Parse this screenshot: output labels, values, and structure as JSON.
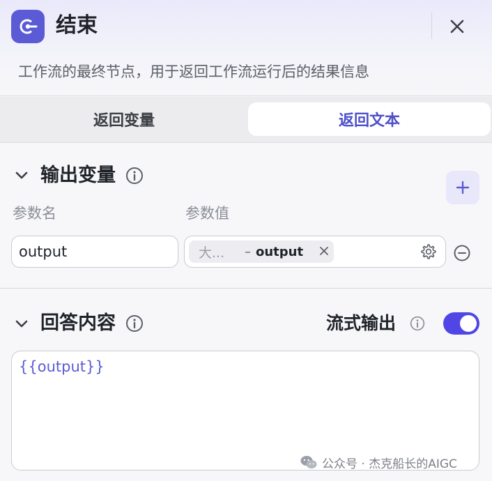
{
  "node": {
    "title": "结束",
    "description": "工作流的最终节点，用于返回工作流运行后的结果信息"
  },
  "tabs": [
    {
      "label": "返回变量",
      "active": false
    },
    {
      "label": "返回文本",
      "active": true
    }
  ],
  "output_section": {
    "title": "输出变量",
    "col_name": "参数名",
    "col_value": "参数值",
    "row": {
      "name": "output",
      "source": "大...",
      "separator": "–",
      "variable": "output"
    }
  },
  "answer_section": {
    "title": "回答内容",
    "stream_label": "流式输出",
    "stream_enabled": true,
    "content": "{{output}}"
  },
  "watermark": {
    "text": "公众号 · 杰克船长的AIGC"
  },
  "colors": {
    "accent": "#5b5bd6",
    "toggle_on": "#4f46e5",
    "active_tab_text": "#4d4fc9"
  }
}
